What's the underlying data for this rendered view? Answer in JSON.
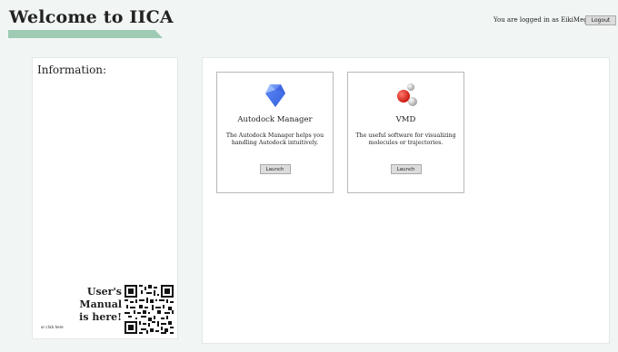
{
  "header": {
    "title": "Welcome to IICA",
    "login_status": "You are logged in as EikiMeg",
    "logout_label": "Logout",
    "accent_color": "#9fcbb5"
  },
  "info": {
    "title": "Information:",
    "manual_line1": "User's Manual",
    "manual_line2": "is here!",
    "click_here": "or click here"
  },
  "apps": [
    {
      "title": "Autodock Manager",
      "description": "The Autodock Manager helps you handling Autodock intuitively.",
      "launch_label": "Launch",
      "icon": "autodock-gem-icon"
    },
    {
      "title": "VMD",
      "description": "The useful software for visualizing molecules or trajectories.",
      "launch_label": "Launch",
      "icon": "molecule-icon"
    }
  ]
}
